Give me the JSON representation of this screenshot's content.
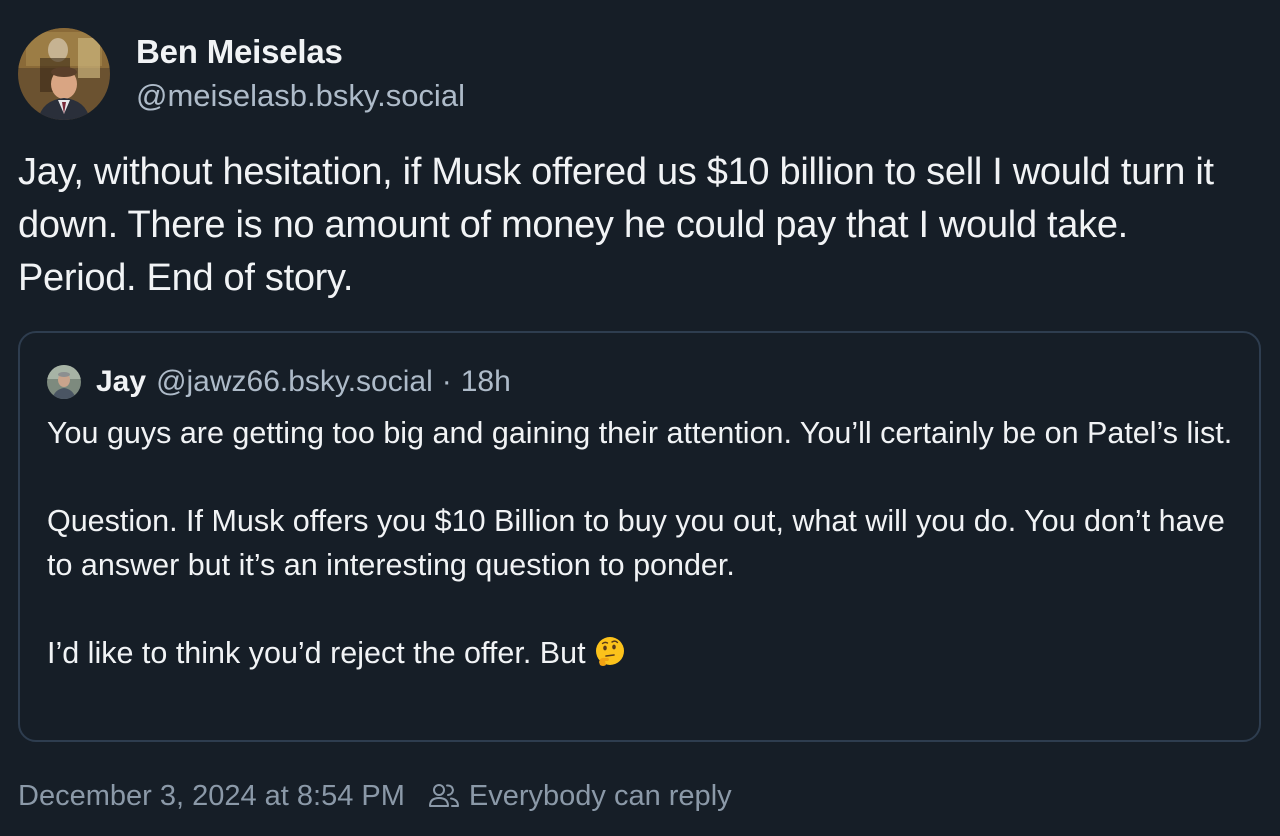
{
  "post": {
    "author": {
      "display_name": "Ben Meiselas",
      "handle": "@meiselasb.bsky.social",
      "avatar_icon": "avatar-photo"
    },
    "text": "Jay, without hesitation, if Musk offered us $10 billion to sell I would turn it down. There is no amount of money he could pay that I would take. Period. End of story.",
    "quoted_post": {
      "author_name": "Jay",
      "author_handle": "@jawz66.bsky.social",
      "separator": "·",
      "time_ago": "18h",
      "avatar_icon": "avatar-photo",
      "paragraphs": [
        "You guys are getting too big and gaining their attention.  You’ll certainly be on Patel’s list.",
        "Question.  If Musk offers you $10 Billion to buy you out, what will you do.  You don’t have to answer but it’s an interesting question to ponder.",
        "I’d like to think you’d reject the offer. But"
      ],
      "trailing_emoji": "thinking-face-emoji"
    },
    "footer": {
      "timestamp": "December 3, 2024 at 8:54 PM",
      "reply_setting_icon": "people-icon",
      "reply_setting": "Everybody can reply"
    }
  },
  "colors": {
    "background": "#161e27",
    "text_primary": "#f1f3f5",
    "text_secondary": "#aebbc9",
    "text_muted": "#8b99a8",
    "card_border": "#2e3d4f"
  }
}
